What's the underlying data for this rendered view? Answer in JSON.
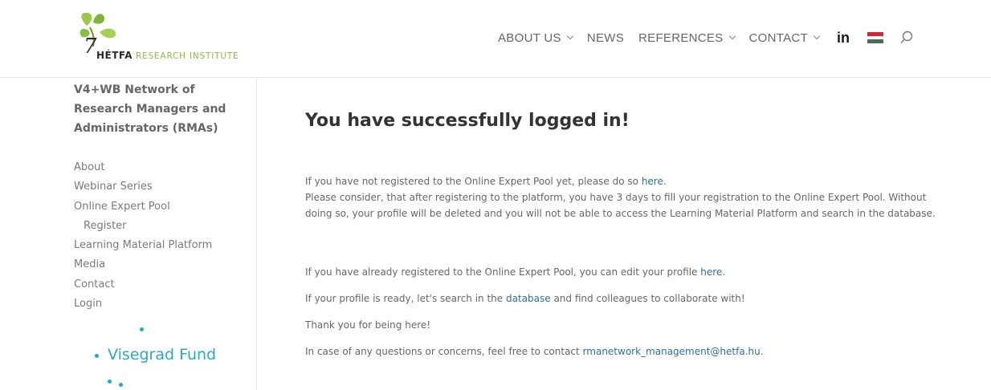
{
  "logo": {
    "brand": "HÉTFA",
    "sub": "RESEARCH INSTITUTE"
  },
  "nav": {
    "items": [
      {
        "label": "ABOUT US",
        "dropdown": true
      },
      {
        "label": "NEWS",
        "dropdown": false
      },
      {
        "label": "REFERENCES",
        "dropdown": true
      },
      {
        "label": "CONTACT",
        "dropdown": true
      }
    ],
    "linkedin_label": "in",
    "flag_colors": [
      "#ce2939",
      "#ffffff",
      "#477050"
    ]
  },
  "sidebar": {
    "title": "V4+WB Network of Research Managers and Administrators (RMAs)",
    "items": [
      {
        "label": "About"
      },
      {
        "label": "Webinar Series"
      },
      {
        "label": "Online Expert Pool"
      },
      {
        "label": "Register"
      },
      {
        "label": "Learning Material Platform"
      },
      {
        "label": "Media"
      },
      {
        "label": "Contact"
      },
      {
        "label": "Login"
      }
    ],
    "sponsor": "Visegrad Fund"
  },
  "main": {
    "heading": "You have successfully logged in!",
    "p1": {
      "line1": "If you have not registered to the Online Expert Pool yet, please do so ",
      "link": "here",
      "line1_end": ".",
      "rest": "Please consider, that after registering to the platform, you have 3 days to fill your registration to the Online Expert Pool. Without doing so, your profile will be deleted and you will not be able to access the Learning Material Platform and search in the database."
    },
    "p2": {
      "text": "If you have already registered to the Online Expert Pool, you can edit your profile ",
      "link": "here",
      "end": "."
    },
    "p3": {
      "text": "If your profile is ready, let's search in the ",
      "link": "database",
      "end": " and find colleagues to collaborate with!"
    },
    "p4": "Thank you for being here!",
    "p5": {
      "text": "In case of any questions or concerns, feel free to contact ",
      "link": "rmanetwork_management@hetfa.hu",
      "end": "."
    }
  },
  "colors": {
    "accent_link": "#2e6da4",
    "brand_green": "#8cbf3f",
    "visegrad_blue": "#2aa9c6"
  }
}
